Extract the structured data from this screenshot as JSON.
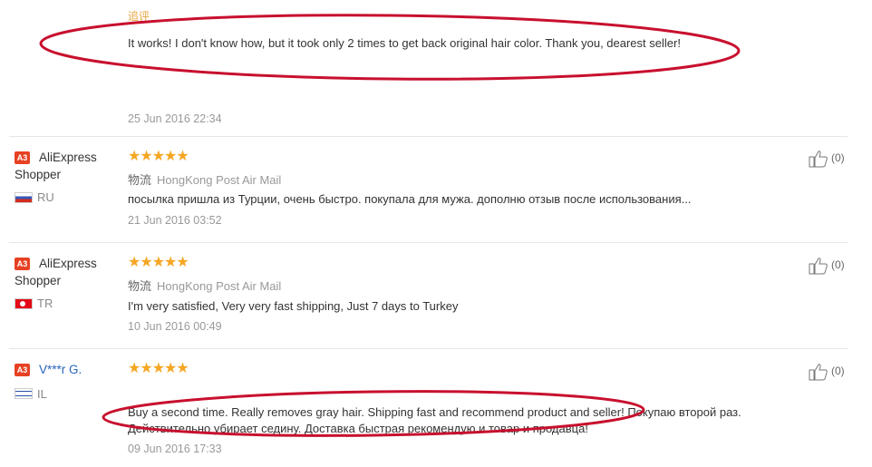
{
  "top_review": {
    "label": "追评",
    "text": "It works! I don't know how, but it took only 2 times to get back original hair color. Thank you, dearest seller!",
    "date": "25 Jun 2016 22:34"
  },
  "reviews": [
    {
      "badge": "A3",
      "name": "AliExpress Shopper",
      "country": "RU",
      "stars": "★★★★★",
      "logistics_label": "物流",
      "logistics": "HongKong Post Air Mail",
      "text": "посылка пришла из Турции, очень быстро. покупала для мужа. дополню отзыв после использования...",
      "date": "21 Jun 2016 03:52",
      "likes": "(0)"
    },
    {
      "badge": "A3",
      "name": "AliExpress Shopper",
      "country": "TR",
      "stars": "★★★★★",
      "logistics_label": "物流",
      "logistics": "HongKong Post Air Mail",
      "text": "I'm very satisfied, Very very fast shipping, Just 7 days to Turkey",
      "date": "10 Jun 2016 00:49",
      "likes": "(0)"
    },
    {
      "badge": "A3",
      "name": "V***r G.",
      "country": "IL",
      "stars": "★★★★★",
      "text_line1": "Buy a second time. Really removes gray hair. Shipping fast and recommend product and seller! Покупаю второй раз.",
      "text_line2": "Действительно убирает седину. Доставка быстрая рекомендую и товар и продавца!",
      "date": "09 Jun 2016 17:33",
      "likes": "(0)"
    }
  ],
  "colors": {
    "annotation_red": "#c8102e",
    "star": "#f5a623",
    "badge": "#e64123",
    "link": "#2a65b8"
  }
}
